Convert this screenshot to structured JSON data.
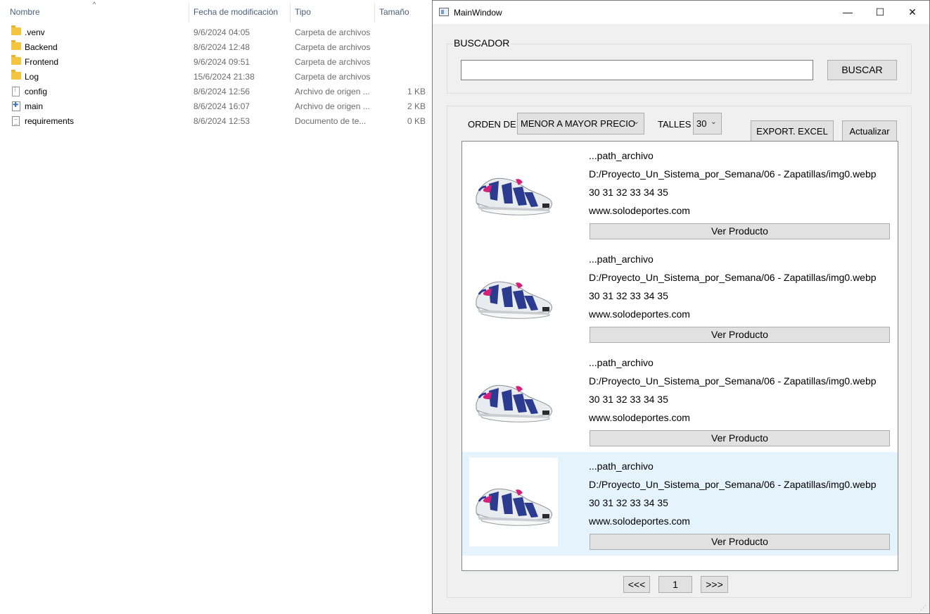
{
  "explorer": {
    "columns": {
      "name": "Nombre",
      "date": "Fecha de modificación",
      "type": "Tipo",
      "size": "Tamaño"
    },
    "files": [
      {
        "icon": "folder-icon",
        "name": ".venv",
        "date": "9/6/2024 04:05",
        "type": "Carpeta de archivos",
        "size": ""
      },
      {
        "icon": "folder-icon",
        "name": "Backend",
        "date": "8/6/2024 12:48",
        "type": "Carpeta de archivos",
        "size": ""
      },
      {
        "icon": "folder-icon",
        "name": "Frontend",
        "date": "9/6/2024 09:51",
        "type": "Carpeta de archivos",
        "size": ""
      },
      {
        "icon": "folder-icon",
        "name": "Log",
        "date": "15/6/2024 21:38",
        "type": "Carpeta de archivos",
        "size": ""
      },
      {
        "icon": "config-file-icon",
        "name": "config",
        "date": "8/6/2024 12:56",
        "type": "Archivo de origen ...",
        "size": "1 KB"
      },
      {
        "icon": "python-file-icon",
        "name": "main",
        "date": "8/6/2024 16:07",
        "type": "Archivo de origen ...",
        "size": "2 KB"
      },
      {
        "icon": "text-file-icon",
        "name": "requirements",
        "date": "8/6/2024 12:53",
        "type": "Documento de te...",
        "size": "0 KB"
      }
    ]
  },
  "window": {
    "title": "MainWindow",
    "minimize": "—",
    "maximize": "☐",
    "close": "✕"
  },
  "search": {
    "group_title": "BUSCADOR",
    "value": "",
    "button": "BUSCAR"
  },
  "filters": {
    "order_label": "ORDEN DE",
    "order_value": "MENOR A MAYOR PRECIO",
    "sizes_label": "TALLES",
    "sizes_value": "30",
    "export_button": "EXPORT. EXCEL",
    "refresh_button": "Actualizar"
  },
  "products": [
    {
      "line1": "...path_archivo",
      "line2": "D:/Proyecto_Un_Sistema_por_Semana/06 - Zapatillas/img0.webp",
      "line3": "30 31 32 33 34 35",
      "line4": "www.solodeportes.com",
      "button": "Ver Producto",
      "selected": false
    },
    {
      "line1": "...path_archivo",
      "line2": "D:/Proyecto_Un_Sistema_por_Semana/06 - Zapatillas/img0.webp",
      "line3": "30 31 32 33 34 35",
      "line4": "www.solodeportes.com",
      "button": "Ver Producto",
      "selected": false
    },
    {
      "line1": "...path_archivo",
      "line2": "D:/Proyecto_Un_Sistema_por_Semana/06 - Zapatillas/img0.webp",
      "line3": "30 31 32 33 34 35",
      "line4": "www.solodeportes.com",
      "button": "Ver Producto",
      "selected": false
    },
    {
      "line1": "...path_archivo",
      "line2": "D:/Proyecto_Un_Sistema_por_Semana/06 - Zapatillas/img0.webp",
      "line3": "30 31 32 33 34 35",
      "line4": "www.solodeportes.com",
      "button": "Ver Producto",
      "selected": true
    }
  ],
  "pagination": {
    "prev": "<<<",
    "page": "1",
    "next": ">>>"
  },
  "colors": {
    "selected_row": "#e5f3fd",
    "button_face": "#e1e1e1",
    "window_bg": "#f0f0f0",
    "folder": "#f3c43d"
  }
}
